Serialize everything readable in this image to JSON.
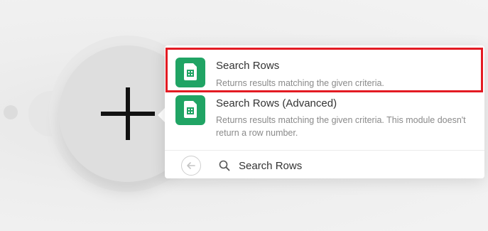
{
  "colors": {
    "app_icon_bg": "#20a464",
    "highlight_border": "#e31b23"
  },
  "canvas": {
    "add_module_icon": "plus-icon"
  },
  "search_results": [
    {
      "icon": "google-sheets-icon",
      "title": "Search Rows",
      "description": "Returns results matching the given criteria."
    },
    {
      "icon": "google-sheets-icon",
      "title": "Search Rows (Advanced)",
      "description": "Returns results matching the given criteria. This module doesn't return a row number."
    }
  ],
  "search_bar": {
    "back_icon": "arrow-left-icon",
    "search_icon": "search-icon",
    "value": "Search Rows"
  }
}
